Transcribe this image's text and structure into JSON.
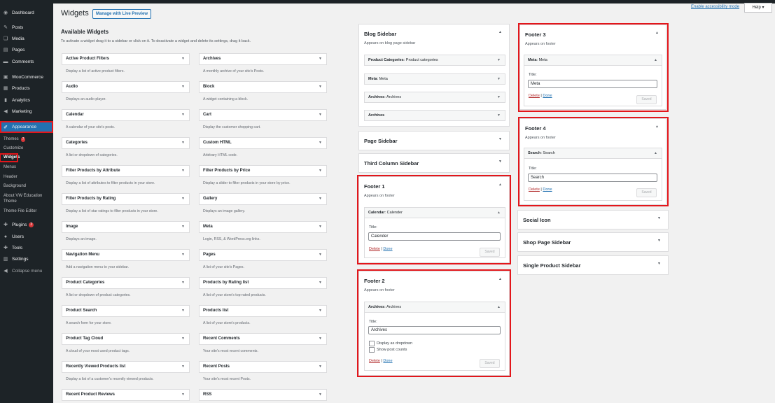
{
  "sidebar": {
    "items": [
      {
        "icon": "dashboard-icon",
        "glyph": "◉",
        "label": "Dashboard"
      },
      {
        "icon": "posts-icon",
        "glyph": "✎",
        "label": "Posts"
      },
      {
        "icon": "media-icon",
        "glyph": "❏",
        "label": "Media"
      },
      {
        "icon": "pages-icon",
        "glyph": "▤",
        "label": "Pages"
      },
      {
        "icon": "comments-icon",
        "glyph": "▬",
        "label": "Comments"
      },
      {
        "icon": "woocommerce-icon",
        "glyph": "▣",
        "label": "WooCommerce"
      },
      {
        "icon": "products-icon",
        "glyph": "▦",
        "label": "Products"
      },
      {
        "icon": "analytics-icon",
        "glyph": "▮",
        "label": "Analytics"
      },
      {
        "icon": "marketing-icon",
        "glyph": "◀",
        "label": "Marketing"
      },
      {
        "icon": "appearance-icon",
        "glyph": "✐",
        "label": "Appearance"
      }
    ],
    "appearance_sub": [
      "Themes",
      "Customize",
      "Widgets",
      "Menus",
      "Header",
      "Background",
      "About VW Education Theme",
      "Theme File Editor"
    ],
    "themes_badge": "7",
    "plugins": {
      "label": "Plugins",
      "badge": "3",
      "glyph": "✚"
    },
    "users": {
      "label": "Users",
      "glyph": "●"
    },
    "tools": {
      "label": "Tools",
      "glyph": "✚"
    },
    "settings": {
      "label": "Settings",
      "glyph": "▥"
    },
    "collapse": {
      "label": "Collapse menu",
      "glyph": "◀"
    }
  },
  "header": {
    "title": "Widgets",
    "live_preview": "Manage with Live Preview",
    "a11y": "Enable accessibility mode",
    "help": "Help ▾"
  },
  "available": {
    "heading": "Available Widgets",
    "desc": "To activate a widget drag it to a sidebar or click on it. To deactivate a widget and delete its settings, drag it back.",
    "left": [
      {
        "name": "Active Product Filters",
        "desc": "Display a list of active product filters."
      },
      {
        "name": "Audio",
        "desc": "Displays an audio player."
      },
      {
        "name": "Calendar",
        "desc": "A calendar of your site's posts."
      },
      {
        "name": "Categories",
        "desc": "A list or dropdown of categories."
      },
      {
        "name": "Filter Products by Attribute",
        "desc": "Display a list of attributes to filter products in your store."
      },
      {
        "name": "Filter Products by Rating",
        "desc": "Display a list of star ratings to filter products in your store."
      },
      {
        "name": "Image",
        "desc": "Displays an image."
      },
      {
        "name": "Navigation Menu",
        "desc": "Add a navigation menu to your sidebar."
      },
      {
        "name": "Product Categories",
        "desc": "A list or dropdown of product categories."
      },
      {
        "name": "Product Search",
        "desc": "A search form for your store."
      },
      {
        "name": "Product Tag Cloud",
        "desc": "A cloud of your most used product tags."
      },
      {
        "name": "Recently Viewed Products list",
        "desc": "Display a list of a customer's recently viewed products."
      },
      {
        "name": "Recent Product Reviews",
        "desc": ""
      }
    ],
    "right": [
      {
        "name": "Archives",
        "desc": "A monthly archive of your site's Posts."
      },
      {
        "name": "Block",
        "desc": "A widget containing a block."
      },
      {
        "name": "Cart",
        "desc": "Display the customer shopping cart."
      },
      {
        "name": "Custom HTML",
        "desc": "Arbitrary HTML code."
      },
      {
        "name": "Filter Products by Price",
        "desc": "Display a slider to filter products in your store by price."
      },
      {
        "name": "Gallery",
        "desc": "Displays an image gallery."
      },
      {
        "name": "Meta",
        "desc": "Login, RSS, & WordPress.org links."
      },
      {
        "name": "Pages",
        "desc": "A list of your site's Pages."
      },
      {
        "name": "Products by Rating list",
        "desc": "A list of your store's top-rated products."
      },
      {
        "name": "Products list",
        "desc": "A list of your store's products."
      },
      {
        "name": "Recent Comments",
        "desc": "Your site's most recent comments."
      },
      {
        "name": "Recent Posts",
        "desc": "Your site's most recent Posts."
      },
      {
        "name": "RSS",
        "desc": ""
      }
    ]
  },
  "blog_sidebar": {
    "title": "Blog Sidebar",
    "desc": "Appears on blog page sidebar",
    "widgets": [
      {
        "name": "Product Categories",
        "sub": ": Product categories"
      },
      {
        "name": "Meta",
        "sub": ": Meta"
      },
      {
        "name": "Archives",
        "sub": ": Archives"
      },
      {
        "name": "Archives",
        "sub": ""
      }
    ]
  },
  "page_sidebar": {
    "title": "Page Sidebar"
  },
  "third_column": {
    "title": "Third Column Sidebar"
  },
  "footer1": {
    "title": "Footer 1",
    "desc": "Appears on footer",
    "widget": "Calendar",
    "widget_sub": ": Calender",
    "title_label": "Title:",
    "value": "Calender",
    "delete": "Delete",
    "sep": " | ",
    "done": "Done",
    "saved": "Saved"
  },
  "footer2": {
    "title": "Footer 2",
    "desc": "Appears on footer",
    "widget": "Archives",
    "widget_sub": ": Archives",
    "title_label": "Title:",
    "value": "Archives",
    "cb1": "Display as dropdown",
    "cb2": "Show post counts",
    "delete": "Delete",
    "sep": " | ",
    "done": "Done",
    "saved": "Saved"
  },
  "footer3": {
    "title": "Footer 3",
    "desc": "Appears on footer",
    "widget": "Meta",
    "widget_sub": ": Meta",
    "title_label": "Title:",
    "value": "Meta",
    "delete": "Delete",
    "sep": " | ",
    "done": "Done",
    "saved": "Saved"
  },
  "footer4": {
    "title": "Footer 4",
    "desc": "Appears on footer",
    "widget": "Search",
    "widget_sub": ": Search",
    "title_label": "Title:",
    "value": "Search",
    "delete": "Delete",
    "sep": " | ",
    "done": "Done",
    "saved": "Saved"
  },
  "social_icon": {
    "title": "Social Icon"
  },
  "shop_page": {
    "title": "Shop Page Sidebar"
  },
  "single_product": {
    "title": "Single Product Sidebar"
  },
  "colors": {
    "accent": "#2271b1",
    "highlight": "#e3161b",
    "sidebar": "#1d2327"
  }
}
